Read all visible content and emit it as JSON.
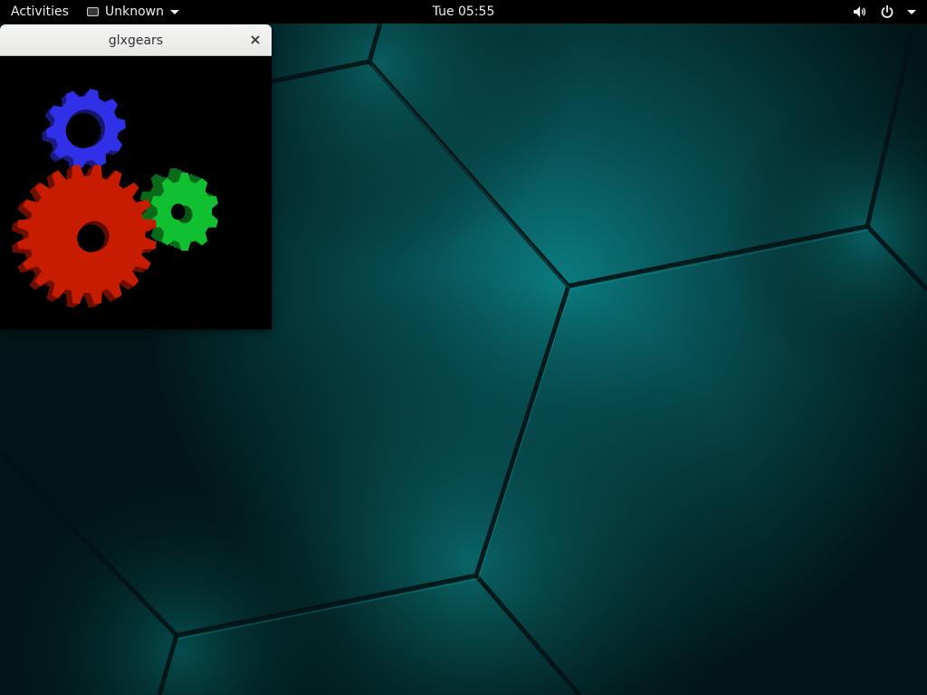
{
  "topbar": {
    "activities_label": "Activities",
    "app_menu_label": "Unknown",
    "clock": "Tue 05:55",
    "icons": [
      "volume-icon",
      "power-icon",
      "system-menu-caret-icon"
    ]
  },
  "window": {
    "title": "glxgears",
    "close_icon": "close-icon",
    "gears": [
      {
        "name": "red-gear",
        "color": "#c81c00"
      },
      {
        "name": "green-gear",
        "color": "#10c030"
      },
      {
        "name": "blue-gear",
        "color": "#3030e8"
      }
    ]
  },
  "colors": {
    "topbar_bg": "#000000",
    "wallpaper_accent": "#0e8a8a",
    "wallpaper_dark": "#021a1c"
  }
}
